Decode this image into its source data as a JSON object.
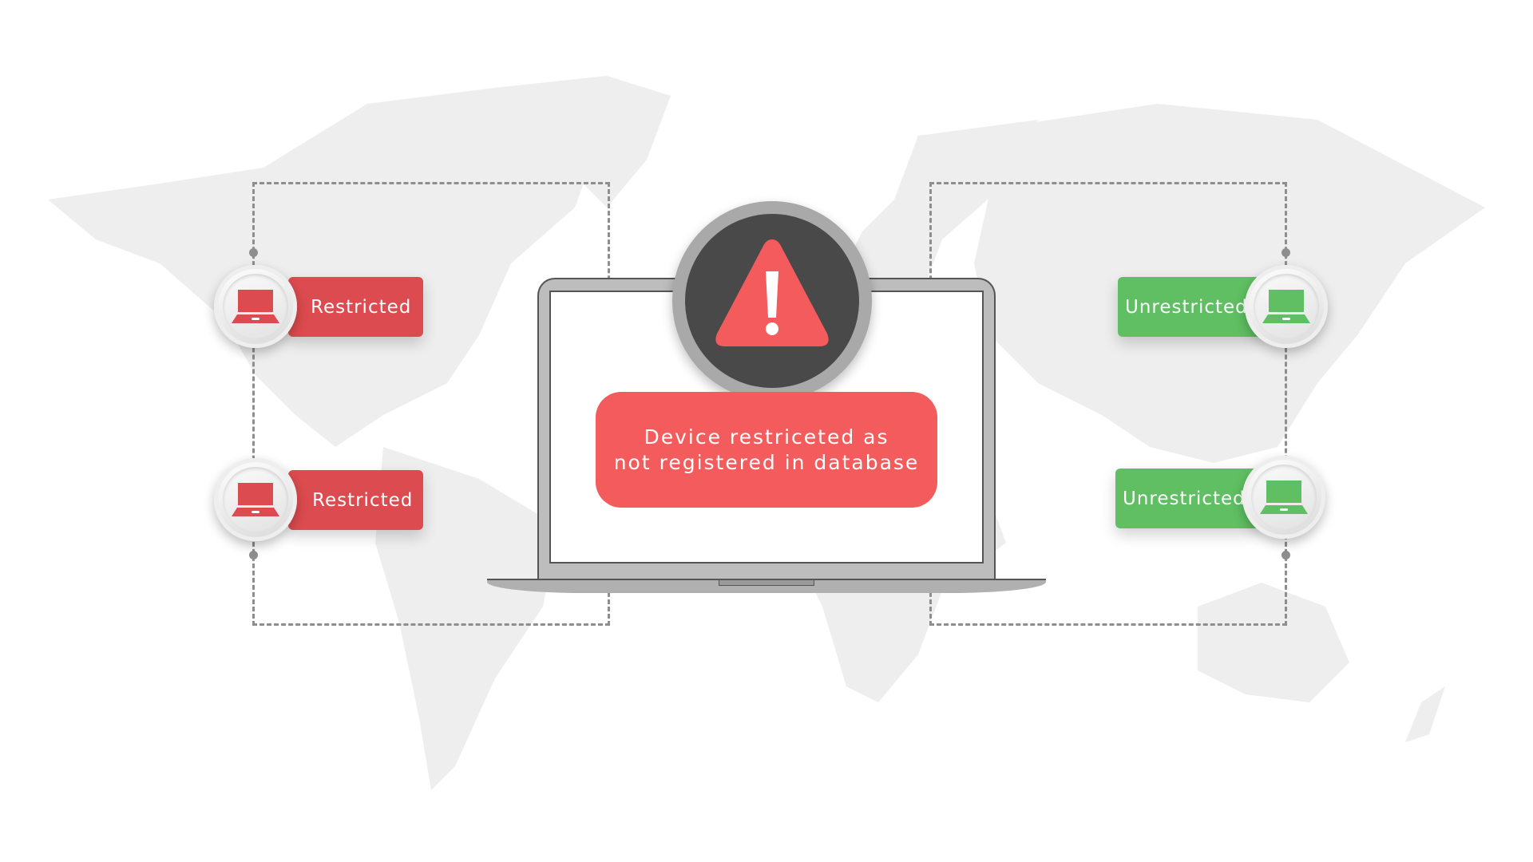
{
  "message": {
    "line1": "Device restriceted as",
    "line2": "not registered in database"
  },
  "devices": [
    {
      "status": "Restricted",
      "color": "#dc4b4f"
    },
    {
      "status": "Restricted",
      "color": "#dc4b4f"
    },
    {
      "status": "Unrestricted",
      "color": "#5fbf62"
    },
    {
      "status": "Unrestricted",
      "color": "#5fbf62"
    }
  ],
  "icons": {
    "device": "laptop-icon",
    "alert": "warning-triangle-icon",
    "background": "world-map"
  },
  "colors": {
    "alert": "#f45b5c",
    "restricted": "#dc4b4f",
    "unrestricted": "#5fbf62",
    "map": "#ececec"
  }
}
